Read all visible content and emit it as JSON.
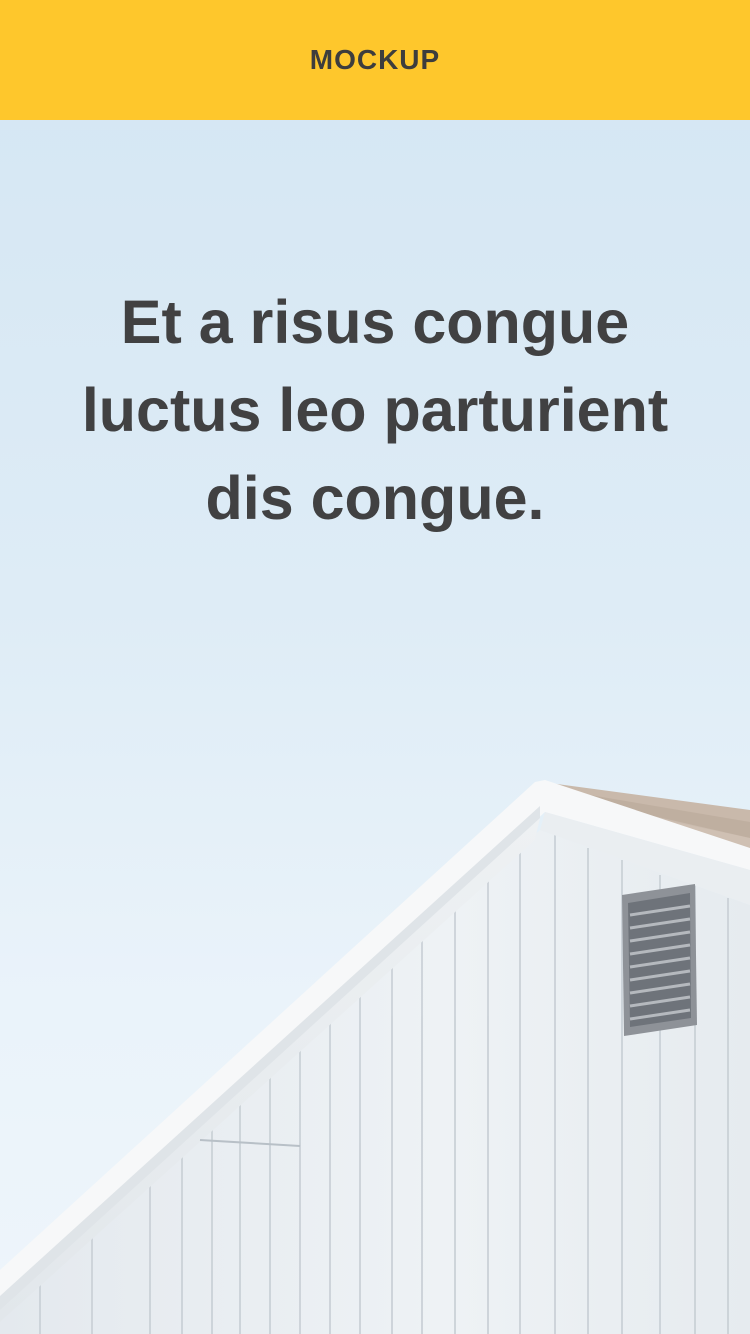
{
  "header": {
    "title": "MOCKUP",
    "background": "#fec72c"
  },
  "hero": {
    "headline": "Et a risus congue luctus leo parturient dis congue.",
    "text_color": "#414142",
    "sky_color": "#d4e6f3"
  },
  "background_image": {
    "icon": "house-roof-photo"
  }
}
